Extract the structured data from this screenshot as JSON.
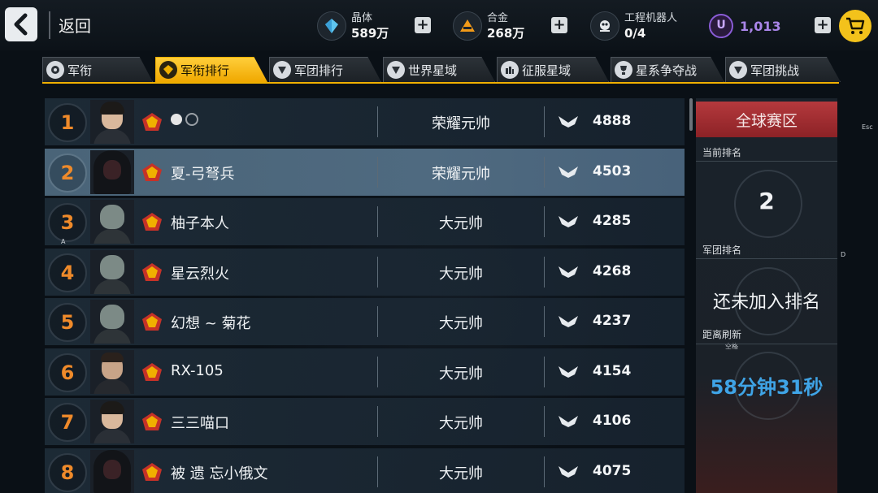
{
  "header": {
    "back_label": "返回",
    "resources": [
      {
        "label": "晶体",
        "value": "589万",
        "icon": "crystal-icon"
      },
      {
        "label": "合金",
        "value": "268万",
        "icon": "alloy-icon"
      },
      {
        "label": "工程机器人",
        "value": "0/4",
        "icon": "robot-icon"
      }
    ],
    "currency": {
      "symbol": "U",
      "value": "1,013"
    }
  },
  "tabs": [
    {
      "label": "军衔",
      "active": false
    },
    {
      "label": "军衔排行",
      "active": true
    },
    {
      "label": "军团排行",
      "active": false
    },
    {
      "label": "世界星域",
      "active": false
    },
    {
      "label": "征服星域",
      "active": false
    },
    {
      "label": "星系争夺战",
      "active": false
    },
    {
      "label": "军团挑战",
      "active": false
    }
  ],
  "rankings": [
    {
      "rank": "1",
      "name": "",
      "title": "荣耀元帅",
      "score": "4888",
      "highlight": false
    },
    {
      "rank": "2",
      "name": "夏-弓弩兵",
      "title": "荣耀元帅",
      "score": "4503",
      "highlight": true
    },
    {
      "rank": "3",
      "name": "柚子本人",
      "title": "大元帅",
      "score": "4285",
      "highlight": false
    },
    {
      "rank": "4",
      "name": "星云烈火",
      "title": "大元帅",
      "score": "4268",
      "highlight": false
    },
    {
      "rank": "5",
      "name": "幻想 ~ 菊花",
      "title": "大元帅",
      "score": "4237",
      "highlight": false
    },
    {
      "rank": "6",
      "name": "RX-105",
      "title": "大元帅",
      "score": "4154",
      "highlight": false
    },
    {
      "rank": "7",
      "name": "三三喵口",
      "title": "大元帅",
      "score": "4106",
      "highlight": false
    },
    {
      "rank": "8",
      "name": "被 遗 忘小俄文",
      "title": "大元帅",
      "score": "4075",
      "highlight": false
    }
  ],
  "panel": {
    "header": "全球赛区",
    "current_rank_label": "当前排名",
    "current_rank": "2",
    "team_rank_label": "军团排名",
    "team_rank_value": "还未加入排名",
    "refresh_label": "距离刷新",
    "refresh_countdown": "58分钟31秒"
  },
  "overlay": {
    "esc": "Esc",
    "d": "D",
    "a": "A",
    "space": "空格"
  },
  "colors": {
    "accent": "#f0b000",
    "rank": "#ef8a2a",
    "countdown": "#3fa4e6",
    "panel_head": "#b5393d"
  }
}
